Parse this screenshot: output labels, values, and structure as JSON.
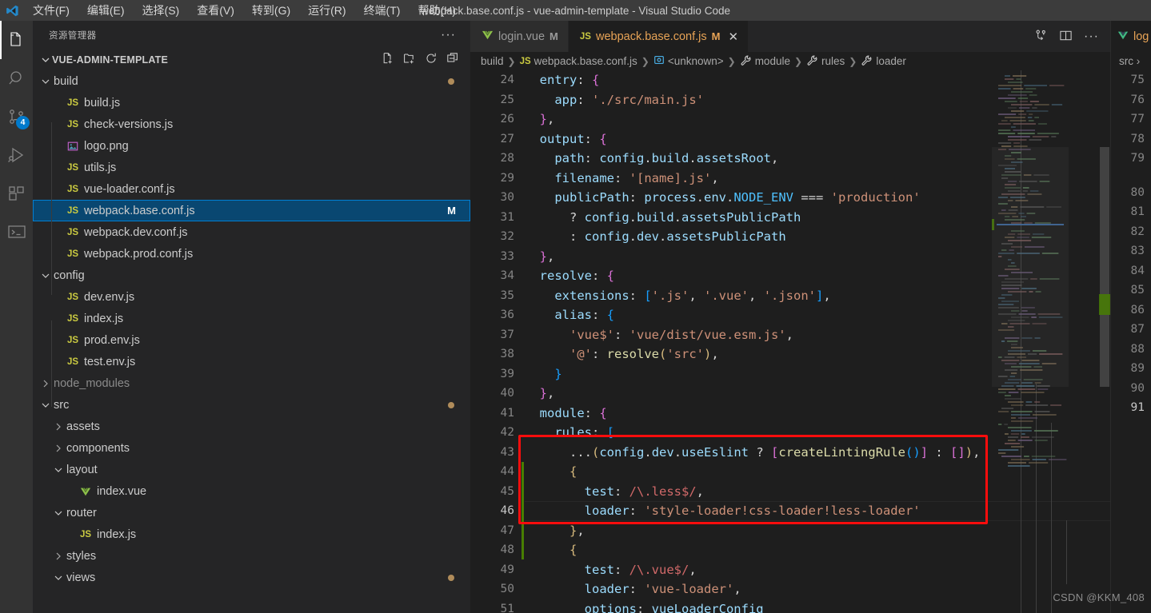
{
  "titlebar": {
    "logo_icon": "vscode-logo-icon",
    "title": "webpack.base.conf.js - vue-admin-template - Visual Studio Code",
    "menus": [
      {
        "label": "文件(F)"
      },
      {
        "label": "编辑(E)"
      },
      {
        "label": "选择(S)"
      },
      {
        "label": "查看(V)"
      },
      {
        "label": "转到(G)"
      },
      {
        "label": "运行(R)"
      },
      {
        "label": "终端(T)"
      },
      {
        "label": "帮助(H)"
      }
    ]
  },
  "activitybar": {
    "items": [
      {
        "name": "explorer-icon",
        "active": true,
        "badge": ""
      },
      {
        "name": "search-icon",
        "active": false,
        "badge": ""
      },
      {
        "name": "source-control-icon",
        "active": false,
        "badge": "4"
      },
      {
        "name": "run-debug-icon",
        "active": false,
        "badge": ""
      },
      {
        "name": "extensions-icon",
        "active": false,
        "badge": ""
      },
      {
        "name": "terminal-icon",
        "active": false,
        "badge": ""
      }
    ]
  },
  "sidebar": {
    "header": "资源管理器",
    "more_label": "···",
    "root": {
      "label": "VUE-ADMIN-TEMPLATE",
      "actions": [
        "new-file-icon",
        "new-folder-icon",
        "refresh-icon",
        "collapse-all-icon"
      ]
    },
    "tree": [
      {
        "depth": 1,
        "type": "folder",
        "label": "build",
        "expanded": true,
        "dot": true
      },
      {
        "depth": 2,
        "type": "js",
        "label": "build.js"
      },
      {
        "depth": 2,
        "type": "js",
        "label": "check-versions.js"
      },
      {
        "depth": 2,
        "type": "img",
        "label": "logo.png"
      },
      {
        "depth": 2,
        "type": "js",
        "label": "utils.js"
      },
      {
        "depth": 2,
        "type": "js",
        "label": "vue-loader.conf.js"
      },
      {
        "depth": 2,
        "type": "js",
        "label": "webpack.base.conf.js",
        "selected": true,
        "mark": "M"
      },
      {
        "depth": 2,
        "type": "js",
        "label": "webpack.dev.conf.js"
      },
      {
        "depth": 2,
        "type": "js",
        "label": "webpack.prod.conf.js"
      },
      {
        "depth": 1,
        "type": "folder",
        "label": "config",
        "expanded": true
      },
      {
        "depth": 2,
        "type": "js",
        "label": "dev.env.js"
      },
      {
        "depth": 2,
        "type": "js",
        "label": "index.js"
      },
      {
        "depth": 2,
        "type": "js",
        "label": "prod.env.js"
      },
      {
        "depth": 2,
        "type": "js",
        "label": "test.env.js"
      },
      {
        "depth": 1,
        "type": "folder",
        "label": "node_modules",
        "expanded": false,
        "dim": true
      },
      {
        "depth": 1,
        "type": "folder",
        "label": "src",
        "expanded": true,
        "dot": true
      },
      {
        "depth": 2,
        "type": "folder",
        "label": "assets",
        "expanded": false
      },
      {
        "depth": 2,
        "type": "folder",
        "label": "components",
        "expanded": false
      },
      {
        "depth": 2,
        "type": "folder",
        "label": "layout",
        "expanded": true
      },
      {
        "depth": 3,
        "type": "vue",
        "label": "index.vue"
      },
      {
        "depth": 2,
        "type": "folder",
        "label": "router",
        "expanded": true
      },
      {
        "depth": 3,
        "type": "js",
        "label": "index.js"
      },
      {
        "depth": 2,
        "type": "folder",
        "label": "styles",
        "expanded": false
      },
      {
        "depth": 2,
        "type": "folder",
        "label": "views",
        "expanded": true,
        "dot": true
      }
    ]
  },
  "editor": {
    "tabs": [
      {
        "icon": "vue-icon",
        "label": "login.vue",
        "modified": "M",
        "active": false,
        "closable": false
      },
      {
        "icon": "js-icon",
        "label": "webpack.base.conf.js",
        "modified": "M",
        "active": true,
        "closable": true,
        "close_glyph": "✕"
      }
    ],
    "tab_actions": [
      "split-diff-icon",
      "split-editor-icon",
      "more-actions-icon"
    ],
    "breadcrumb": [
      {
        "icon": "",
        "label": "build"
      },
      {
        "icon": "js-icon",
        "label": "webpack.base.conf.js"
      },
      {
        "icon": "module-icon",
        "label": "<unknown>"
      },
      {
        "icon": "property-icon",
        "label": "module"
      },
      {
        "icon": "property-icon",
        "label": "rules"
      },
      {
        "icon": "property-icon",
        "label": "loader"
      }
    ],
    "first_line": 24,
    "current_line": 46,
    "lines": [
      {
        "n": 24,
        "tokens": [
          {
            "t": "  ",
            "c": "t-plain"
          },
          {
            "t": "entry",
            "c": "t-prop"
          },
          {
            "t": ": ",
            "c": "t-plain"
          },
          {
            "t": "{",
            "c": "p-p"
          }
        ]
      },
      {
        "n": 25,
        "tokens": [
          {
            "t": "    ",
            "c": "t-plain"
          },
          {
            "t": "app",
            "c": "t-prop"
          },
          {
            "t": ": ",
            "c": "t-plain"
          },
          {
            "t": "'./src/main.js'",
            "c": "t-str"
          }
        ]
      },
      {
        "n": 26,
        "tokens": [
          {
            "t": "  ",
            "c": "t-plain"
          },
          {
            "t": "}",
            "c": "p-p"
          },
          {
            "t": ",",
            "c": "t-plain"
          }
        ]
      },
      {
        "n": 27,
        "tokens": [
          {
            "t": "  ",
            "c": "t-plain"
          },
          {
            "t": "output",
            "c": "t-prop"
          },
          {
            "t": ": ",
            "c": "t-plain"
          },
          {
            "t": "{",
            "c": "p-p"
          }
        ]
      },
      {
        "n": 28,
        "tokens": [
          {
            "t": "    ",
            "c": "t-plain"
          },
          {
            "t": "path",
            "c": "t-prop"
          },
          {
            "t": ": ",
            "c": "t-plain"
          },
          {
            "t": "config",
            "c": "t-prop"
          },
          {
            "t": ".",
            "c": "t-plain"
          },
          {
            "t": "build",
            "c": "t-prop"
          },
          {
            "t": ".",
            "c": "t-plain"
          },
          {
            "t": "assetsRoot",
            "c": "t-prop"
          },
          {
            "t": ",",
            "c": "t-plain"
          }
        ]
      },
      {
        "n": 29,
        "tokens": [
          {
            "t": "    ",
            "c": "t-plain"
          },
          {
            "t": "filename",
            "c": "t-prop"
          },
          {
            "t": ": ",
            "c": "t-plain"
          },
          {
            "t": "'[name].js'",
            "c": "t-str"
          },
          {
            "t": ",",
            "c": "t-plain"
          }
        ]
      },
      {
        "n": 30,
        "tokens": [
          {
            "t": "    ",
            "c": "t-plain"
          },
          {
            "t": "publicPath",
            "c": "t-prop"
          },
          {
            "t": ": ",
            "c": "t-plain"
          },
          {
            "t": "process",
            "c": "t-prop"
          },
          {
            "t": ".",
            "c": "t-plain"
          },
          {
            "t": "env",
            "c": "t-prop"
          },
          {
            "t": ".",
            "c": "t-plain"
          },
          {
            "t": "NODE_ENV",
            "c": "t-const"
          },
          {
            "t": " === ",
            "c": "t-plain"
          },
          {
            "t": "'production'",
            "c": "t-str"
          }
        ]
      },
      {
        "n": 31,
        "tokens": [
          {
            "t": "      ? ",
            "c": "t-plain"
          },
          {
            "t": "config",
            "c": "t-prop"
          },
          {
            "t": ".",
            "c": "t-plain"
          },
          {
            "t": "build",
            "c": "t-prop"
          },
          {
            "t": ".",
            "c": "t-plain"
          },
          {
            "t": "assetsPublicPath",
            "c": "t-prop"
          }
        ]
      },
      {
        "n": 32,
        "tokens": [
          {
            "t": "      : ",
            "c": "t-plain"
          },
          {
            "t": "config",
            "c": "t-prop"
          },
          {
            "t": ".",
            "c": "t-plain"
          },
          {
            "t": "dev",
            "c": "t-prop"
          },
          {
            "t": ".",
            "c": "t-plain"
          },
          {
            "t": "assetsPublicPath",
            "c": "t-prop"
          }
        ]
      },
      {
        "n": 33,
        "tokens": [
          {
            "t": "  ",
            "c": "t-plain"
          },
          {
            "t": "}",
            "c": "p-p"
          },
          {
            "t": ",",
            "c": "t-plain"
          }
        ]
      },
      {
        "n": 34,
        "tokens": [
          {
            "t": "  ",
            "c": "t-plain"
          },
          {
            "t": "resolve",
            "c": "t-prop"
          },
          {
            "t": ": ",
            "c": "t-plain"
          },
          {
            "t": "{",
            "c": "p-p"
          }
        ]
      },
      {
        "n": 35,
        "tokens": [
          {
            "t": "    ",
            "c": "t-plain"
          },
          {
            "t": "extensions",
            "c": "t-prop"
          },
          {
            "t": ": ",
            "c": "t-plain"
          },
          {
            "t": "[",
            "c": "p-b"
          },
          {
            "t": "'.js'",
            "c": "t-str"
          },
          {
            "t": ", ",
            "c": "t-plain"
          },
          {
            "t": "'.vue'",
            "c": "t-str"
          },
          {
            "t": ", ",
            "c": "t-plain"
          },
          {
            "t": "'.json'",
            "c": "t-str"
          },
          {
            "t": "]",
            "c": "p-b"
          },
          {
            "t": ",",
            "c": "t-plain"
          }
        ]
      },
      {
        "n": 36,
        "tokens": [
          {
            "t": "    ",
            "c": "t-plain"
          },
          {
            "t": "alias",
            "c": "t-prop"
          },
          {
            "t": ": ",
            "c": "t-plain"
          },
          {
            "t": "{",
            "c": "p-b"
          }
        ]
      },
      {
        "n": 37,
        "tokens": [
          {
            "t": "      ",
            "c": "t-plain"
          },
          {
            "t": "'vue$'",
            "c": "t-str"
          },
          {
            "t": ": ",
            "c": "t-plain"
          },
          {
            "t": "'vue/dist/vue.esm.js'",
            "c": "t-str"
          },
          {
            "t": ",",
            "c": "t-plain"
          }
        ]
      },
      {
        "n": 38,
        "tokens": [
          {
            "t": "      ",
            "c": "t-plain"
          },
          {
            "t": "'@'",
            "c": "t-str"
          },
          {
            "t": ": ",
            "c": "t-plain"
          },
          {
            "t": "resolve",
            "c": "t-fn"
          },
          {
            "t": "(",
            "c": "p-y"
          },
          {
            "t": "'src'",
            "c": "t-str"
          },
          {
            "t": ")",
            "c": "p-y"
          },
          {
            "t": ",",
            "c": "t-plain"
          }
        ]
      },
      {
        "n": 39,
        "tokens": [
          {
            "t": "    ",
            "c": "t-plain"
          },
          {
            "t": "}",
            "c": "p-b"
          }
        ]
      },
      {
        "n": 40,
        "tokens": [
          {
            "t": "  ",
            "c": "t-plain"
          },
          {
            "t": "}",
            "c": "p-p"
          },
          {
            "t": ",",
            "c": "t-plain"
          }
        ]
      },
      {
        "n": 41,
        "tokens": [
          {
            "t": "  ",
            "c": "t-plain"
          },
          {
            "t": "module",
            "c": "t-prop"
          },
          {
            "t": ": ",
            "c": "t-plain"
          },
          {
            "t": "{",
            "c": "p-p"
          }
        ]
      },
      {
        "n": 42,
        "tokens": [
          {
            "t": "    ",
            "c": "t-plain"
          },
          {
            "t": "rules",
            "c": "t-prop"
          },
          {
            "t": ": ",
            "c": "t-plain"
          },
          {
            "t": "[",
            "c": "p-b"
          }
        ]
      },
      {
        "n": 43,
        "tokens": [
          {
            "t": "      ...",
            "c": "t-plain"
          },
          {
            "t": "(",
            "c": "p-y"
          },
          {
            "t": "config",
            "c": "t-prop"
          },
          {
            "t": ".",
            "c": "t-plain"
          },
          {
            "t": "dev",
            "c": "t-prop"
          },
          {
            "t": ".",
            "c": "t-plain"
          },
          {
            "t": "useEslint",
            "c": "t-prop"
          },
          {
            "t": " ? ",
            "c": "t-plain"
          },
          {
            "t": "[",
            "c": "p-p"
          },
          {
            "t": "createLintingRule",
            "c": "t-fn"
          },
          {
            "t": "(",
            "c": "p-b"
          },
          {
            "t": ")",
            "c": "p-b"
          },
          {
            "t": "]",
            "c": "p-p"
          },
          {
            "t": " : ",
            "c": "t-plain"
          },
          {
            "t": "[]",
            "c": "p-p"
          },
          {
            "t": ")",
            "c": "p-y"
          },
          {
            "t": ",",
            "c": "t-plain"
          }
        ]
      },
      {
        "n": 44,
        "tokens": [
          {
            "t": "      ",
            "c": "t-plain"
          },
          {
            "t": "{",
            "c": "p-y"
          }
        ]
      },
      {
        "n": 45,
        "tokens": [
          {
            "t": "        ",
            "c": "t-plain"
          },
          {
            "t": "test",
            "c": "t-prop"
          },
          {
            "t": ": ",
            "c": "t-plain"
          },
          {
            "t": "/\\.less$/",
            "c": "t-re"
          },
          {
            "t": ",",
            "c": "t-plain"
          }
        ]
      },
      {
        "n": 46,
        "tokens": [
          {
            "t": "        ",
            "c": "t-plain"
          },
          {
            "t": "loader",
            "c": "t-prop"
          },
          {
            "t": ": ",
            "c": "t-plain"
          },
          {
            "t": "'style-loader!css-loader!less-loader'",
            "c": "t-str"
          }
        ]
      },
      {
        "n": 47,
        "tokens": [
          {
            "t": "      ",
            "c": "t-plain"
          },
          {
            "t": "}",
            "c": "p-y"
          },
          {
            "t": ",",
            "c": "t-plain"
          }
        ]
      },
      {
        "n": 48,
        "tokens": [
          {
            "t": "      ",
            "c": "t-plain"
          },
          {
            "t": "{",
            "c": "p-y"
          }
        ]
      },
      {
        "n": 49,
        "tokens": [
          {
            "t": "        ",
            "c": "t-plain"
          },
          {
            "t": "test",
            "c": "t-prop"
          },
          {
            "t": ": ",
            "c": "t-plain"
          },
          {
            "t": "/\\.vue$/",
            "c": "t-re"
          },
          {
            "t": ",",
            "c": "t-plain"
          }
        ]
      },
      {
        "n": 50,
        "tokens": [
          {
            "t": "        ",
            "c": "t-plain"
          },
          {
            "t": "loader",
            "c": "t-prop"
          },
          {
            "t": ": ",
            "c": "t-plain"
          },
          {
            "t": "'vue-loader'",
            "c": "t-str"
          },
          {
            "t": ",",
            "c": "t-plain"
          }
        ]
      },
      {
        "n": 51,
        "tokens": [
          {
            "t": "        ",
            "c": "t-plain"
          },
          {
            "t": "options",
            "c": "t-prop"
          },
          {
            "t": ": ",
            "c": "t-plain"
          },
          {
            "t": "vueLoaderConfig",
            "c": "t-prop"
          }
        ]
      }
    ],
    "annotation": {
      "name": "red-highlight-box",
      "color": "#fb0d0d",
      "covers_lines": "43-47"
    }
  },
  "pane2": {
    "tab": {
      "icon": "vue-icon",
      "label": "log"
    },
    "breadcrumb": "src ›",
    "line_numbers": [
      75,
      76,
      77,
      78,
      79,
      80,
      81,
      82,
      83,
      84,
      85,
      86,
      87,
      88,
      89,
      90,
      91
    ],
    "current_line": 91
  },
  "watermark": "CSDN @KKM_408"
}
